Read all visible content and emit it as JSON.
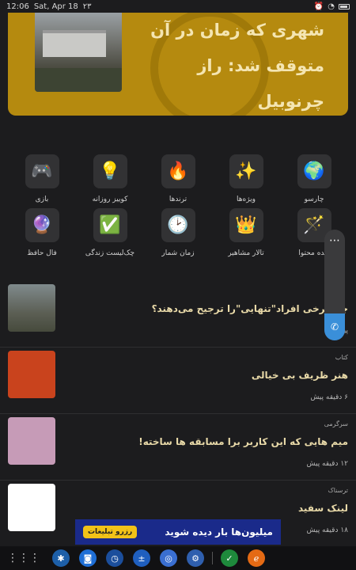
{
  "status": {
    "time": "12:06",
    "date": "Sat, Apr 18",
    "notif": "۲۳"
  },
  "hero": {
    "title": "شهری که زمان در آن متوقف شد: راز چرنوبیل"
  },
  "tiles": [
    {
      "label": "چارسو",
      "icon": "🌍",
      "name": "globe-icon"
    },
    {
      "label": "ویژه‌ها",
      "icon": "✨",
      "name": "sparkles-icon"
    },
    {
      "label": "ترندها",
      "icon": "🔥",
      "name": "fire-icon"
    },
    {
      "label": "کوییز روزانه",
      "icon": "💡",
      "name": "bulb-icon"
    },
    {
      "label": "بازی",
      "icon": "🎮",
      "name": "gamepad-icon"
    },
    {
      "label": "دیده محتوا",
      "icon": "🪄",
      "name": "magic-wand-icon"
    },
    {
      "label": "تالار مشاهیر",
      "icon": "👑",
      "name": "crown-icon"
    },
    {
      "label": "زمان شمار",
      "icon": "🕑",
      "name": "clock-icon"
    },
    {
      "label": "چک‌لیست زندگی",
      "icon": "✅",
      "name": "checklist-icon"
    },
    {
      "label": "فال حافظ",
      "icon": "🔮",
      "name": "crystal-ball-icon"
    }
  ],
  "feed": [
    {
      "category": "",
      "title": "چرا برخی افراد\"تنهایی\"را ترجیح می‌دهند؟",
      "time": "پیش"
    },
    {
      "category": "کتاب",
      "title": "هنر ظریف بی خیالی",
      "time": "۶ دقیقه پیش"
    },
    {
      "category": "سرگرمی",
      "title": "میم هایی که این کاربر برا مسابقه ها ساخته!",
      "time": "۱۲ دقیقه پیش"
    },
    {
      "category": "ترسناک",
      "title": "لینک سفید",
      "time": "۱۸ دقیقه پیش"
    }
  ],
  "ad": {
    "main": "میلیون‌ها بار دیده شوید",
    "cta": "رزرو تبلیغات"
  },
  "colors": {
    "hero_bg": "#b58a0f",
    "page_bg": "#1c1c1e",
    "tile_bg": "#323234",
    "accent_call": "#3a8fd9"
  }
}
